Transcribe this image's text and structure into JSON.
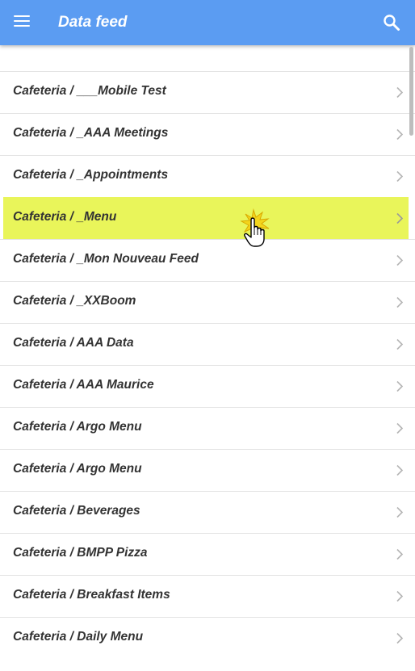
{
  "app_bar": {
    "title": "Data feed",
    "menu_icon": "menu-icon",
    "search_icon": "search-icon",
    "color": "#5b9cf2"
  },
  "list": {
    "selected_index": 3,
    "highlight_color": "#e9f55a",
    "items": [
      {
        "label": "Cafeteria / ___Mobile Test"
      },
      {
        "label": "Cafeteria / _AAA Meetings"
      },
      {
        "label": "Cafeteria / _Appointments"
      },
      {
        "label": "Cafeteria / _Menu"
      },
      {
        "label": "Cafeteria / _Mon Nouveau Feed"
      },
      {
        "label": "Cafeteria / _XXBoom"
      },
      {
        "label": "Cafeteria / AAA Data"
      },
      {
        "label": "Cafeteria / AAA Maurice"
      },
      {
        "label": "Cafeteria / Argo Menu"
      },
      {
        "label": "Cafeteria / Argo Menu"
      },
      {
        "label": "Cafeteria / Beverages"
      },
      {
        "label": "Cafeteria / BMPP Pizza"
      },
      {
        "label": "Cafeteria / Breakfast Items"
      },
      {
        "label": "Cafeteria / Daily Menu"
      }
    ]
  }
}
